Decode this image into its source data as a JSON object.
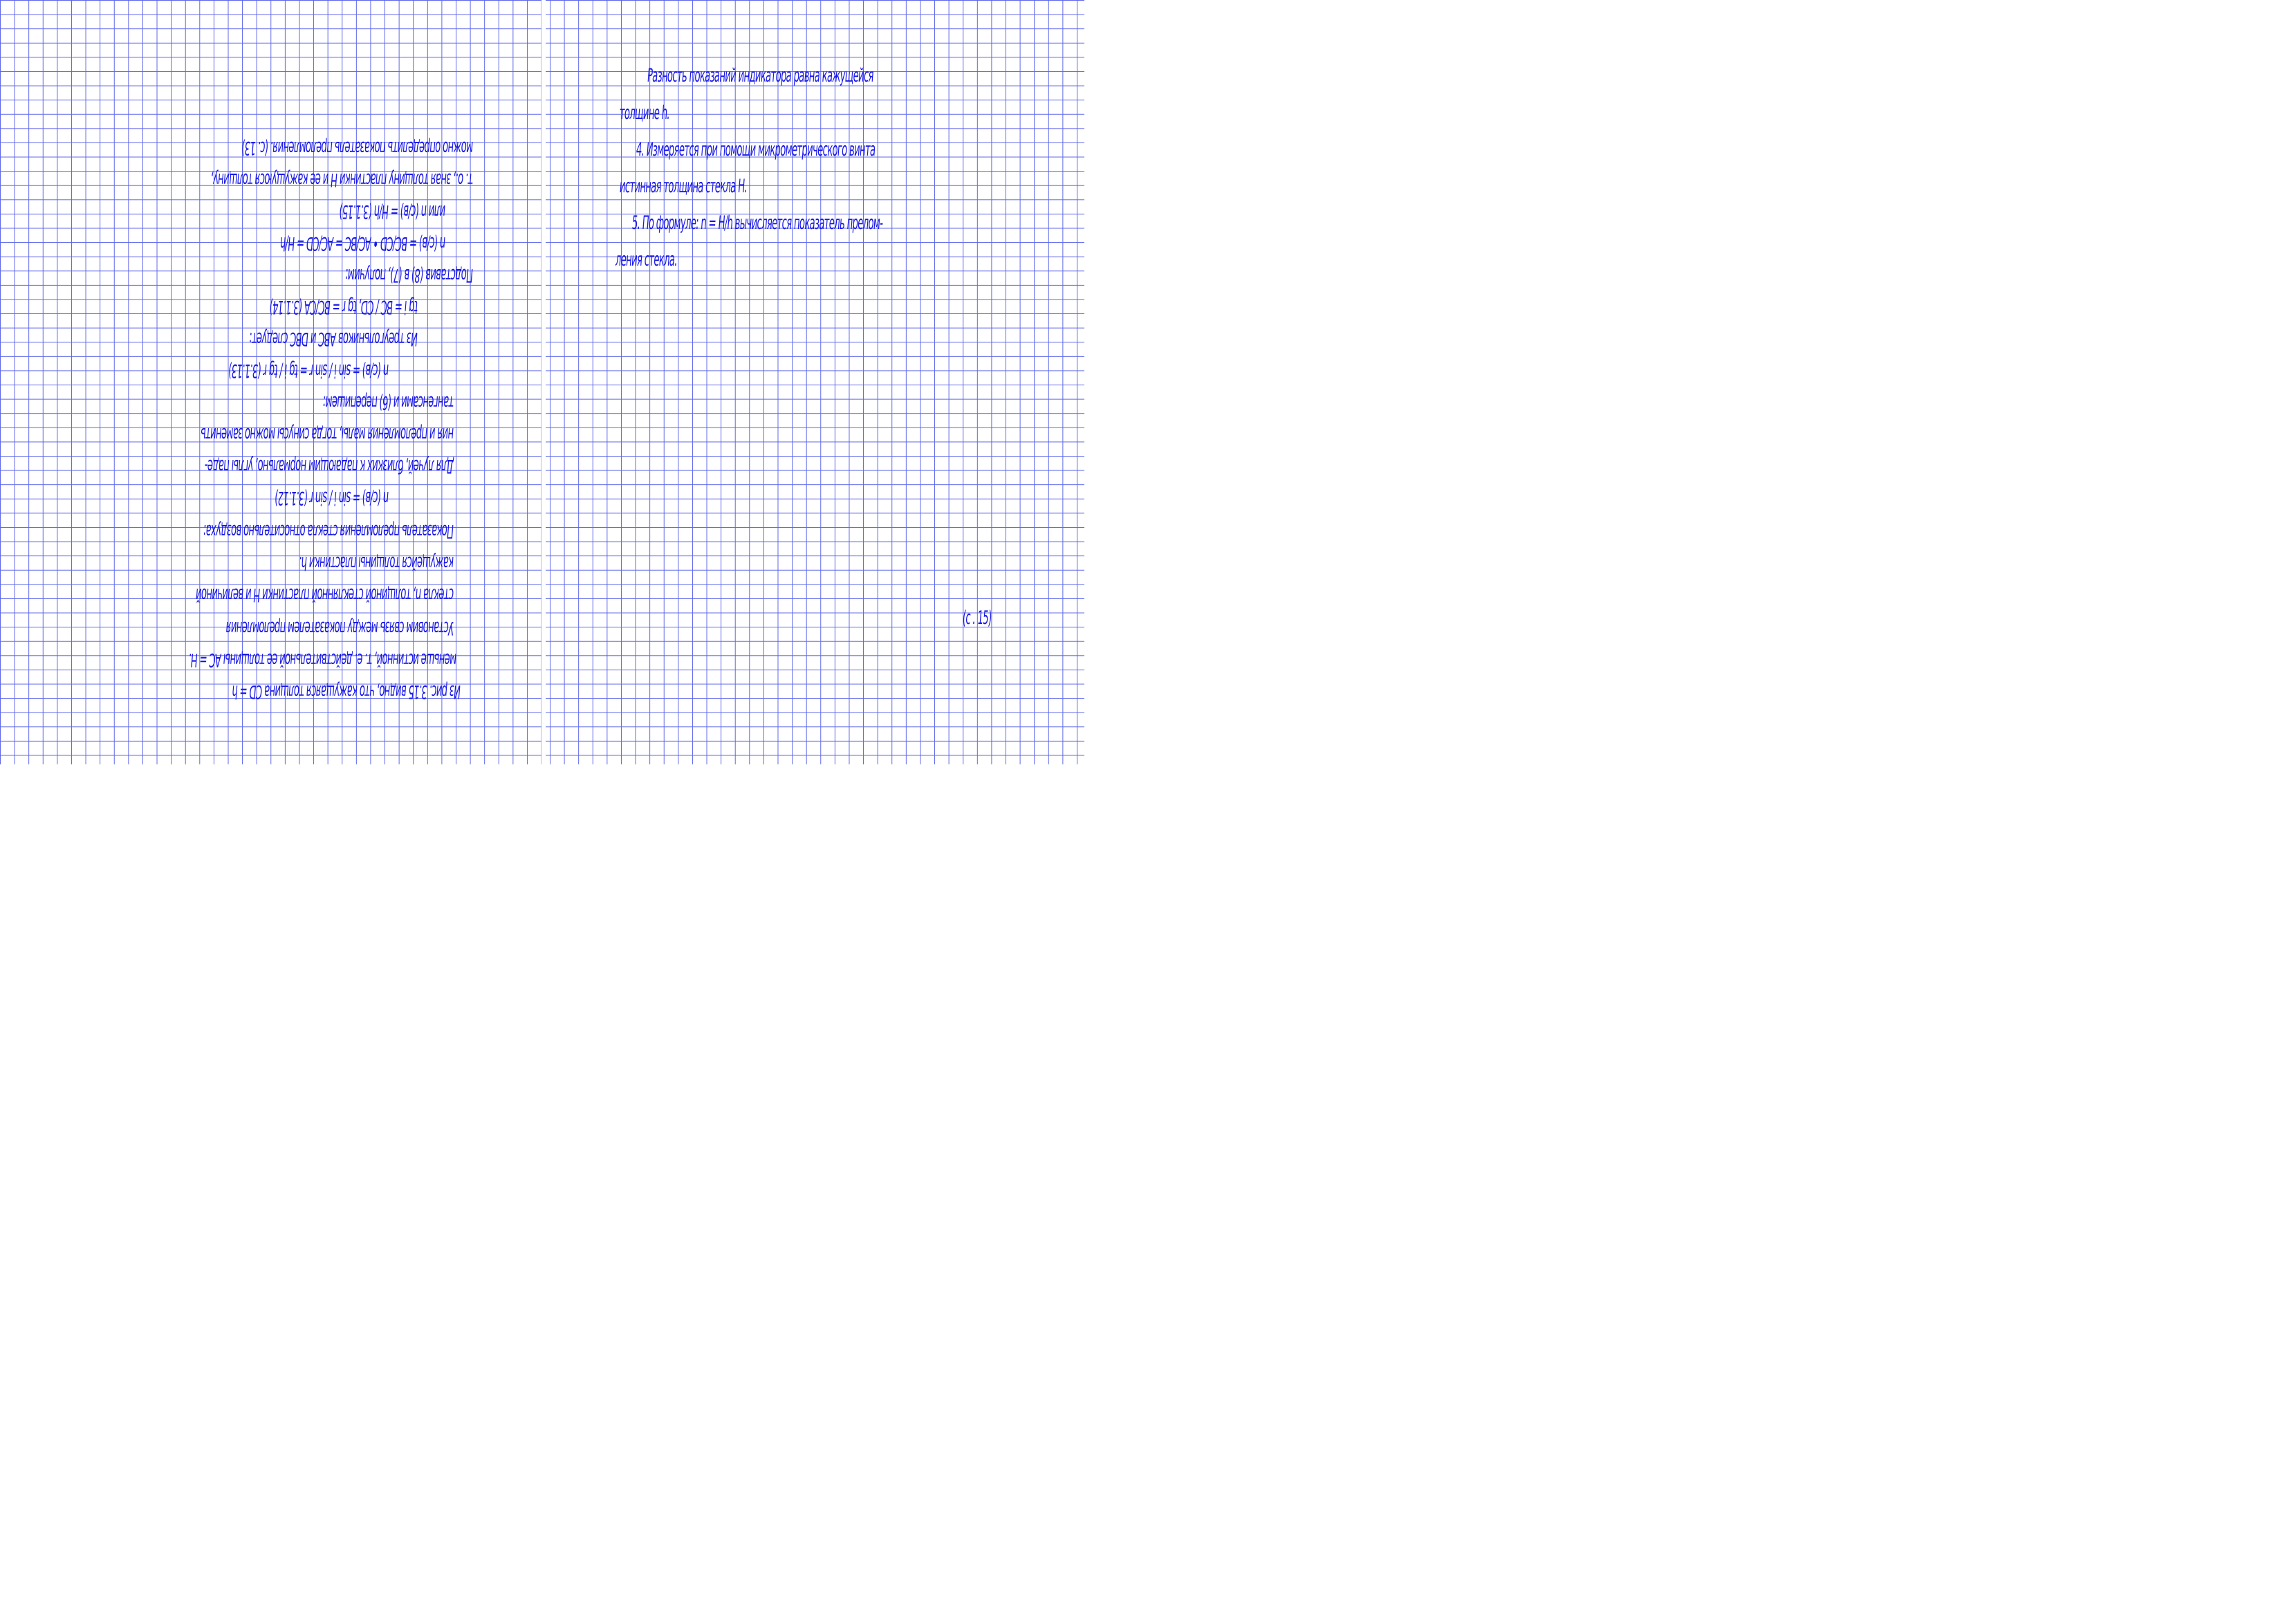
{
  "left_page": {
    "lines": [
      "Из рис. 3.15 видно, что кажущаяся толщина CD = h",
      "меньше истинной, т. е. действительной ее толщины AC = H.",
      "Установим связь между показателем преломления",
      "стекла n, толщиной стеклянной пластинки H и величиной",
      "кажущейся толщины пластинки h.",
      "Показатель преломления стекла относительно воздуха:",
      "n (с/в)  = sin i / sin r            (3.1.12)",
      "Для лучей, близких к падающим нормально, углы паде-",
      "ния и преломления малы, тогда синусы можно заменить",
      "тангенсами и (6) перепишем:",
      "n (с/в) = sin i / sin r = tg i / tg r    (3.1.13)",
      "Из треугольников ABC и DBC следует:",
      "tg i = BC / CD, tg r = BC/CA          (3.1.14)",
      "Подставив (8) в (7), получим:",
      "n (с/в) = BC/CD • AC/BC = AC/CD = H/h",
      "или n (с/в) = H/h                    (3.1.15)",
      "т. о., зная толщину пластинки H и ее кажущуюся толщину,",
      "можно определить показатель преломления.  (с. 13)"
    ]
  },
  "right_page": {
    "lines": [
      "Разность показаний индикатора равна кажущейся",
      "толщине h.",
      "4. Измеряется при помощи микрометрического винта",
      "истинная толщина стекла H.",
      "5. По формуле: n = H/h вычисляется показатель прелом-",
      "ления стекла."
    ],
    "page_number": "(с . 15)"
  },
  "colors": {
    "ink": "#1a1ae6",
    "grid": "#5b64e8",
    "paper": "#ffffff"
  }
}
